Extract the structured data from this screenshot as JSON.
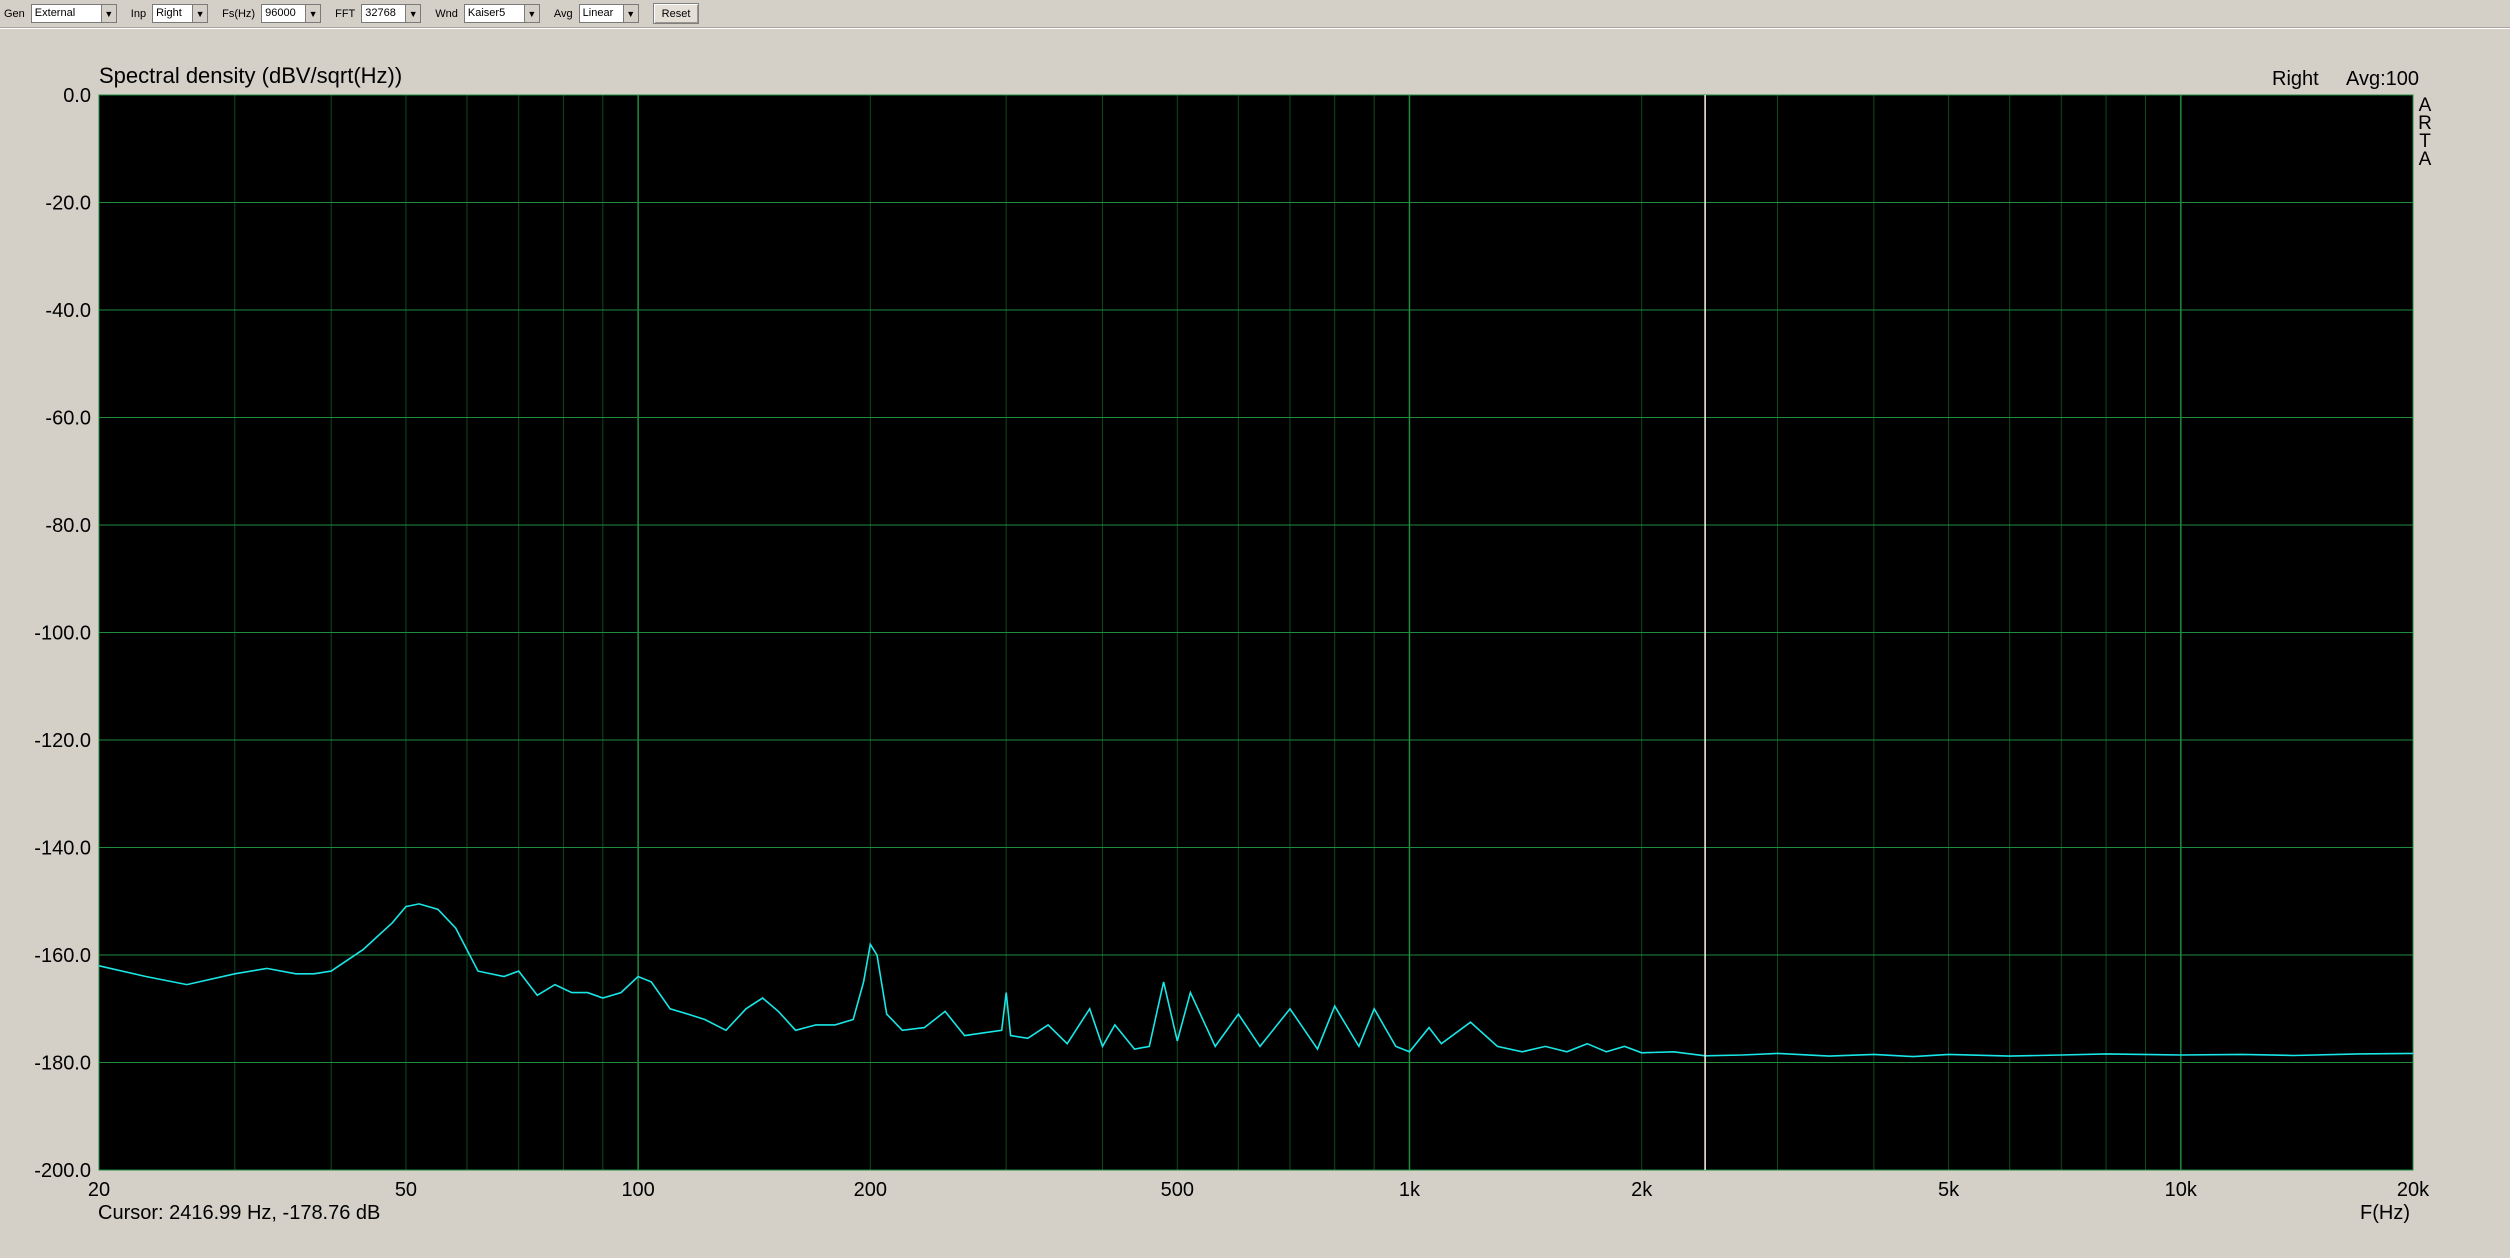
{
  "toolbar": {
    "gen": {
      "label": "Gen",
      "value": "External"
    },
    "inp": {
      "label": "Inp",
      "value": "Right"
    },
    "fs": {
      "label": "Fs(Hz)",
      "value": "96000"
    },
    "fft": {
      "label": "FFT",
      "value": "32768"
    },
    "wnd": {
      "label": "Wnd",
      "value": "Kaiser5"
    },
    "avg": {
      "label": "Avg",
      "value": "Linear"
    },
    "reset_label": "Reset"
  },
  "status": {
    "channel": "Right",
    "averages": "Avg:100",
    "brand_letters": [
      "A",
      "R",
      "T",
      "A"
    ],
    "cursor_readout": "Cursor: 2416.99 Hz, -178.76 dB"
  },
  "colors": {
    "background": "#d4d0c8",
    "plot_background": "#000000",
    "grid_major": "#1f8c3e",
    "grid_minor": "#0d4a1f",
    "trace": "#19e6e6",
    "cursor_line": "#fff8e0"
  },
  "chart_data": {
    "type": "line",
    "title": "Spectral density (dBV/sqrt(Hz))",
    "xlabel": "F(Hz)",
    "ylabel": "",
    "x_scale": "log",
    "xlim": [
      20,
      20000
    ],
    "ylim": [
      -200,
      0
    ],
    "x_ticks": [
      {
        "value": 20,
        "label": "20"
      },
      {
        "value": 50,
        "label": "50"
      },
      {
        "value": 100,
        "label": "100"
      },
      {
        "value": 200,
        "label": "200"
      },
      {
        "value": 500,
        "label": "500"
      },
      {
        "value": 1000,
        "label": "1k"
      },
      {
        "value": 2000,
        "label": "2k"
      },
      {
        "value": 5000,
        "label": "5k"
      },
      {
        "value": 10000,
        "label": "10k"
      },
      {
        "value": 20000,
        "label": "20k"
      }
    ],
    "y_ticks": [
      0,
      -20,
      -40,
      -60,
      -80,
      -100,
      -120,
      -140,
      -160,
      -180,
      -200
    ],
    "y_tick_labels": [
      "0.0",
      "-20.0",
      "-40.0",
      "-60.0",
      "-80.0",
      "-100.0",
      "-120.0",
      "-140.0",
      "-160.0",
      "-180.0",
      "-200.0"
    ],
    "grid": true,
    "cursor": {
      "x": 2416.99,
      "y": -178.76
    },
    "series": [
      {
        "x": [
          20,
          23,
          26,
          30,
          33,
          36,
          38,
          40,
          44,
          48,
          50,
          52,
          55,
          58,
          62,
          67,
          70,
          74,
          78,
          82,
          86,
          90,
          95,
          100,
          104,
          110,
          116,
          122,
          130,
          138,
          145,
          152,
          160,
          170,
          180,
          190,
          196,
          200,
          204,
          210,
          220,
          235,
          250,
          265,
          280,
          296,
          300,
          304,
          320,
          340,
          360,
          385,
          400,
          415,
          440,
          460,
          480,
          500,
          520,
          560,
          600,
          640,
          700,
          760,
          800,
          860,
          900,
          960,
          1000,
          1060,
          1100,
          1200,
          1300,
          1400,
          1500,
          1600,
          1700,
          1800,
          1900,
          2000,
          2200,
          2417,
          2700,
          3000,
          3500,
          4000,
          4500,
          5000,
          6000,
          7000,
          8000,
          10000,
          12000,
          14000,
          17000,
          20000
        ],
        "y": [
          -162,
          -164,
          -165.5,
          -163.5,
          -162.5,
          -163.5,
          -163.5,
          -163,
          -159,
          -154,
          -151,
          -150.5,
          -151.5,
          -155,
          -163,
          -164,
          -163,
          -167.5,
          -165.5,
          -167,
          -167,
          -168,
          -167,
          -164,
          -165,
          -170,
          -171,
          -172,
          -174,
          -170,
          -168,
          -170.5,
          -174,
          -173,
          -173,
          -172,
          -165,
          -158,
          -160,
          -171,
          -174,
          -173.5,
          -170.5,
          -175,
          -174.5,
          -174,
          -167,
          -175,
          -175.5,
          -173,
          -176.5,
          -170,
          -177,
          -173,
          -177.5,
          -177,
          -165,
          -176,
          -167,
          -177,
          -171,
          -177,
          -170,
          -177.5,
          -169.5,
          -177,
          -170,
          -177,
          -178,
          -173.5,
          -176.5,
          -172.5,
          -177,
          -178,
          -177,
          -178,
          -176.5,
          -178,
          -177,
          -178.2,
          -178,
          -178.76,
          -178.6,
          -178.3,
          -178.8,
          -178.5,
          -178.9,
          -178.5,
          -178.8,
          -178.6,
          -178.4,
          -178.6,
          -178.5,
          -178.7,
          -178.4,
          -178.3
        ]
      }
    ]
  }
}
